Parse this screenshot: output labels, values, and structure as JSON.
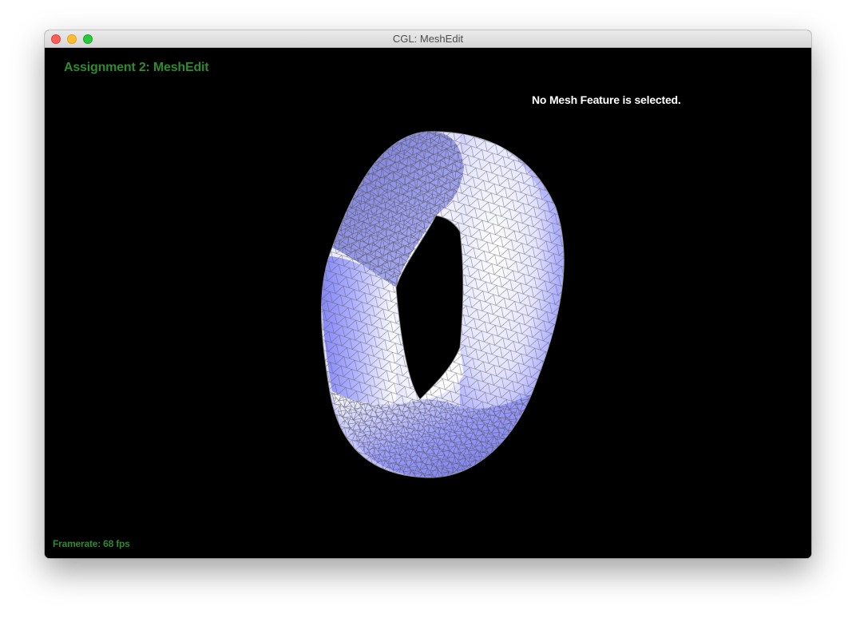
{
  "window": {
    "title": "CGL: MeshEdit"
  },
  "viewport": {
    "app_title": "Assignment 2: MeshEdit",
    "selection_status": "No Mesh Feature is selected.",
    "framerate_label": "Framerate:",
    "framerate_value": "68 fps",
    "model_icon": "torus-mesh",
    "colors": {
      "background": "#000000",
      "title_green": "#2e8b2e",
      "mesh_base": "#8a8cff",
      "mesh_highlight": "#ffffff",
      "wire": "#5a5a5a"
    }
  }
}
